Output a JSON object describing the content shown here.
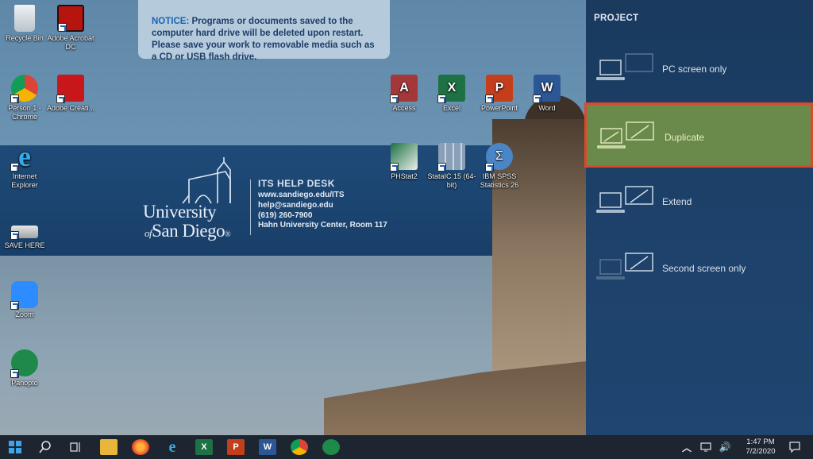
{
  "notice": {
    "label": "NOTICE:",
    "text": "Programs or documents saved to the computer hard drive will be deleted upon restart.  Please save your work to removable media such as a CD or USB flash drive."
  },
  "desktop_icons": [
    {
      "label": "Recycle Bin"
    },
    {
      "label": "Adobe Acrobat DC"
    },
    {
      "label": "Person 1 - Chrome"
    },
    {
      "label": "Adobe Creati..."
    },
    {
      "label": "Internet Explorer"
    },
    {
      "label": "SAVE HERE"
    },
    {
      "label": "Zoom"
    },
    {
      "label": "Panopto"
    },
    {
      "label": "Access"
    },
    {
      "label": "Excel"
    },
    {
      "label": "PowerPoint"
    },
    {
      "label": "Word"
    },
    {
      "label": "PHStat2"
    },
    {
      "label": "StataIC 15 (64-bit)"
    },
    {
      "label": "IBM SPSS Statistics 26"
    }
  ],
  "banner": {
    "name_line1": "University",
    "name_of": "of",
    "name_line2": "San Diego",
    "reg": "®",
    "title": "ITS HELP DESK",
    "lines": [
      "www.sandiego.edu/ITS",
      "help@sandiego.edu",
      "(619) 260-7900",
      "Hahn University Center, Room 117"
    ]
  },
  "project_panel": {
    "title": "PROJECT",
    "options": [
      {
        "label": "PC screen only",
        "selected": false
      },
      {
        "label": "Duplicate",
        "selected": true
      },
      {
        "label": "Extend",
        "selected": false
      },
      {
        "label": "Second screen only",
        "selected": false
      }
    ],
    "colors": {
      "selected_bg": "#6a8a4c",
      "selected_border": "#d94a2b"
    }
  },
  "taskbar": {
    "icons": [
      "windows-start-icon",
      "search-icon",
      "task-view-icon",
      "file-explorer-icon",
      "firefox-icon",
      "internet-explorer-icon",
      "excel-icon",
      "powerpoint-icon",
      "word-icon",
      "chrome-icon",
      "panopto-icon"
    ],
    "time": "1:47 PM",
    "date": "7/2/2020"
  }
}
